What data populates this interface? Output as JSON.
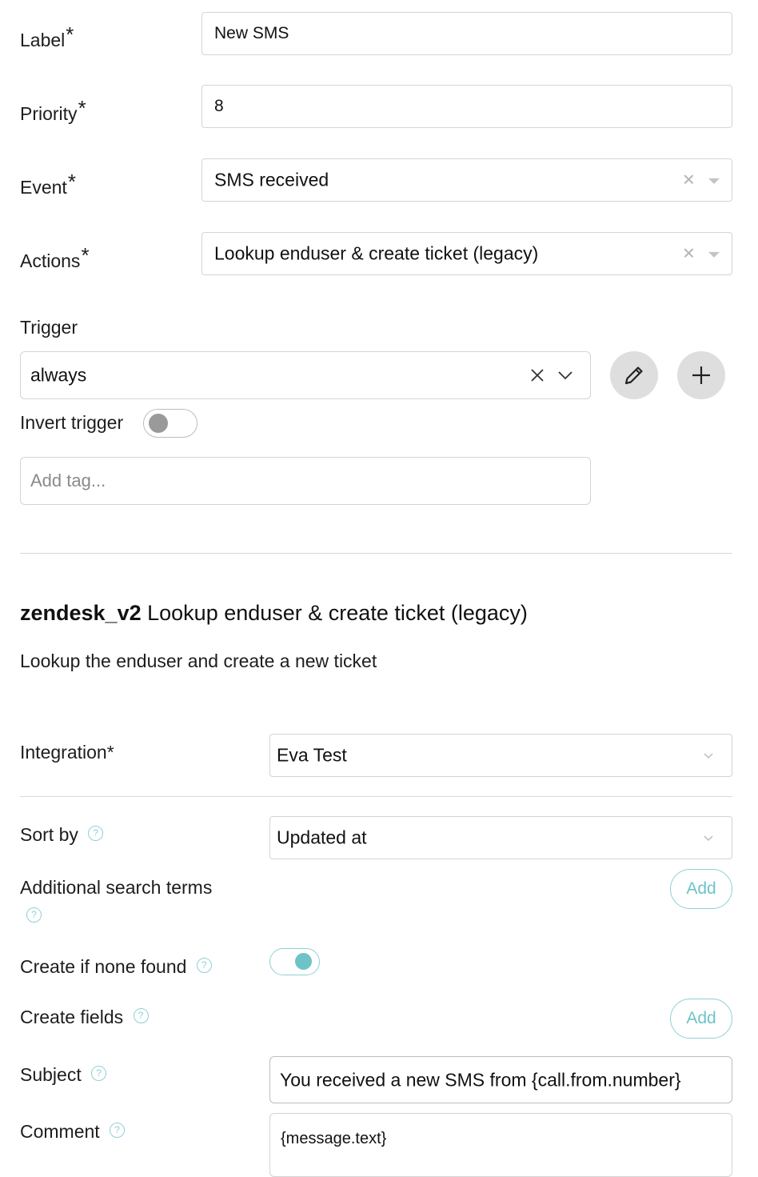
{
  "form": {
    "label": {
      "title": "Label",
      "required_mark": "*",
      "value": "New SMS"
    },
    "priority": {
      "title": "Priority",
      "required_mark": "*",
      "value": "8"
    },
    "event": {
      "title": "Event",
      "required_mark": "*",
      "value": "SMS received"
    },
    "actions": {
      "title": "Actions",
      "required_mark": "*",
      "value": "Lookup enduser & create ticket (legacy)"
    },
    "trigger": {
      "title": "Trigger",
      "value": "always",
      "invert_label": "Invert trigger",
      "invert_on": false
    },
    "tags": {
      "placeholder": "Add tag..."
    }
  },
  "action_section": {
    "integration_code": "zendesk_v2",
    "action_name": "Lookup enduser & create ticket (legacy)",
    "description": "Lookup the enduser and create a new ticket",
    "integration": {
      "title": "Integration*",
      "value": "Eva Test"
    },
    "sort_by": {
      "title": "Sort by",
      "value": "Updated at",
      "help": "?"
    },
    "search_terms": {
      "title": "Additional search terms",
      "help": "?",
      "add_label": "Add"
    },
    "create_if_none": {
      "title": "Create if none found",
      "help": "?",
      "enabled": true
    },
    "create_fields": {
      "title": "Create fields",
      "help": "?",
      "add_label": "Add"
    },
    "subject": {
      "title": "Subject",
      "help": "?",
      "value": "You received a new SMS from {call.from.number}"
    },
    "comment": {
      "title": "Comment",
      "help": "?",
      "value": "{message.text}"
    }
  },
  "colors": {
    "accent": "#8fd0d3",
    "toggle_on": "#6ec3c7",
    "border": "#d4d4d4",
    "muted_button": "#dedede"
  },
  "icons": [
    "clear-icon",
    "caret-down-icon",
    "chevron-down-icon",
    "pencil-icon",
    "plus-icon",
    "help-icon"
  ]
}
